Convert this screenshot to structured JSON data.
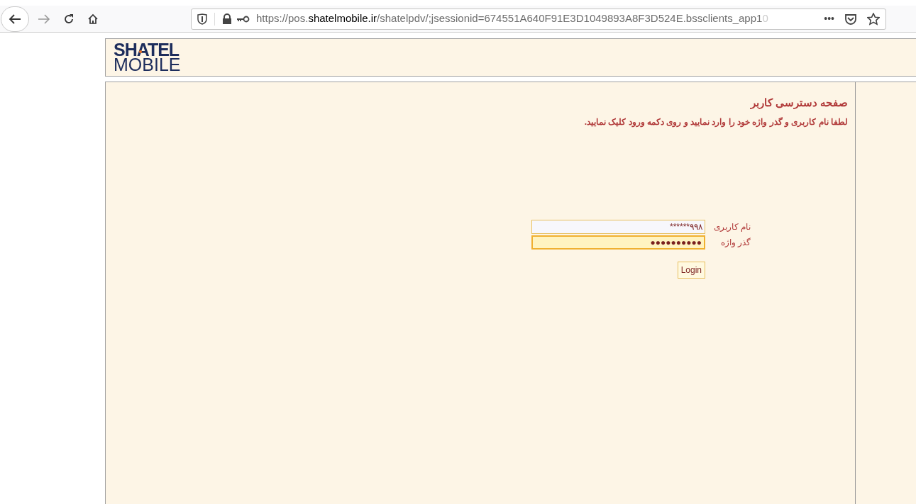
{
  "browser": {
    "url_prefix": "https://pos.",
    "url_domain": "shatelmobile.ir",
    "url_rest": "/shatelpdv/;jsessionid=674551A640F91E3D1049893A8F3D524E.bssclients_app1",
    "url_fade": "0",
    "more": "•••"
  },
  "header": {
    "logo_top": "SHATEL",
    "logo_bottom": "MOBILE"
  },
  "login": {
    "title": "صفحه دسترسی کاربر",
    "instruction": "لطفا نام کاربری و گذر واژه خود را وارد نمایید و روی دکمه ورود کلیک نمایید.",
    "fields": [
      {
        "label": "نام کاربری",
        "value": "******۹۹۸",
        "focused": false
      },
      {
        "label": "گذر واژه",
        "value": "●●●●●●●●●●",
        "focused": true
      }
    ],
    "button": "Login"
  }
}
